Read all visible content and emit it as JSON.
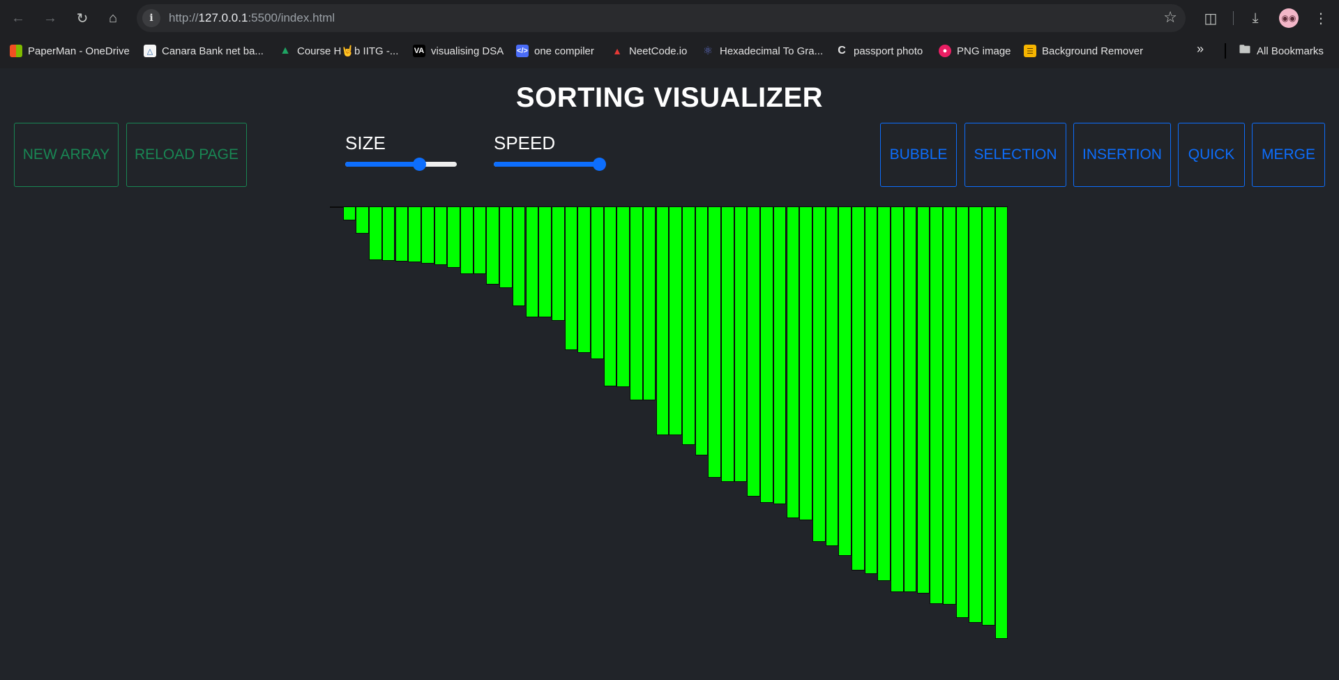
{
  "browser": {
    "url_prefix": "http://",
    "url_host": "127.0.0.1",
    "url_rest": ":5500/index.html",
    "bookmarks": [
      {
        "label": "PaperMan - OneDrive",
        "icon": "microsoft-icon",
        "color": "#f25022"
      },
      {
        "label": "Canara Bank net ba...",
        "icon": "canara-icon",
        "color": "#f5f5f5"
      },
      {
        "label": "Course H🤘b IITG -...",
        "icon": "drive-icon",
        "color": "#1fa463"
      },
      {
        "label": "visualising DSA",
        "icon": "va-icon",
        "color": "#000000"
      },
      {
        "label": "one compiler",
        "icon": "code-icon",
        "color": "#4a6cf7"
      },
      {
        "label": "NeetCode.io",
        "icon": "rocket-icon",
        "color": "#2b2b2b"
      },
      {
        "label": "Hexadecimal To Gra...",
        "icon": "atom-icon",
        "color": "#3b3f9b"
      },
      {
        "label": "passport photo",
        "icon": "c-icon",
        "color": "#2b2b2b"
      },
      {
        "label": "PNG image",
        "icon": "png-icon",
        "color": "#e91e63"
      },
      {
        "label": "Background Remover",
        "icon": "layers-icon",
        "color": "#f5b400"
      }
    ],
    "all_bookmarks": "All Bookmarks"
  },
  "page": {
    "title": "SORTING VISUALIZER",
    "buttons": {
      "new_array": "NEW ARRAY",
      "reload_page": "RELOAD PAGE",
      "bubble": "BUBBLE",
      "selection": "SELECTION",
      "insertion": "INSERTION",
      "quick": "QUICK",
      "merge": "MERGE"
    },
    "size_label": "SIZE",
    "speed_label": "SPEED",
    "size_value": 0.66,
    "speed_value": 1.0,
    "colors": {
      "bar": "#00ff00",
      "success": "#198754",
      "primary": "#0d6efd"
    }
  },
  "array_values": [
    2,
    20,
    39,
    77,
    78,
    79,
    80,
    82,
    84,
    88,
    97,
    97,
    112,
    117,
    143,
    159,
    159,
    164,
    206,
    210,
    219,
    258,
    259,
    278,
    278,
    328,
    328,
    342,
    357,
    389,
    395,
    395,
    416,
    425,
    427,
    447,
    450,
    481,
    487,
    501,
    522,
    527,
    537,
    553,
    553,
    555,
    570,
    571,
    590,
    597,
    601,
    620
  ]
}
